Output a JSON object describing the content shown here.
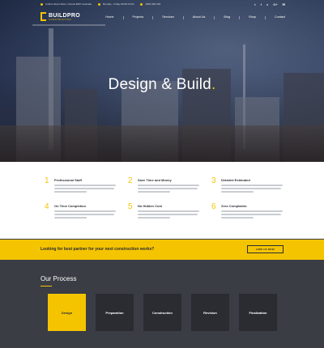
{
  "topbar": {
    "address": "Collins Street West, Victoria 8007 Australia",
    "hours": "Monday - Friday 08:00-19:00",
    "phone": "1800-456-403",
    "socials": [
      "t",
      "f",
      "v",
      "G+",
      "✉"
    ]
  },
  "brand": {
    "name": "BUILDPRO",
    "tagline": "CONSTRUCTION"
  },
  "nav": {
    "items": [
      "Home",
      "Projects",
      "Services",
      "About Us",
      "Blog",
      "Shop",
      "Contact"
    ]
  },
  "hero": {
    "title": "Design & Build",
    "accent": "."
  },
  "features": [
    {
      "num": "1",
      "title": "Professional Staff"
    },
    {
      "num": "2",
      "title": "Save Time and Money"
    },
    {
      "num": "3",
      "title": "Detailed Estimated"
    },
    {
      "num": "4",
      "title": "On Time Completion"
    },
    {
      "num": "5",
      "title": "No Hidden Cost"
    },
    {
      "num": "6",
      "title": "Zero Complaints"
    }
  ],
  "cta": {
    "text": "Looking for best partner for your next construction works?",
    "button": "HIRE US NOW"
  },
  "process": {
    "title": "Our Process",
    "steps": [
      "Design",
      "Preparation",
      "Construction",
      "Revision",
      "Finalization"
    ],
    "active_index": 0
  },
  "colors": {
    "accent": "#f5c400",
    "dark": "#3a3d44",
    "card": "#2a2c32"
  }
}
